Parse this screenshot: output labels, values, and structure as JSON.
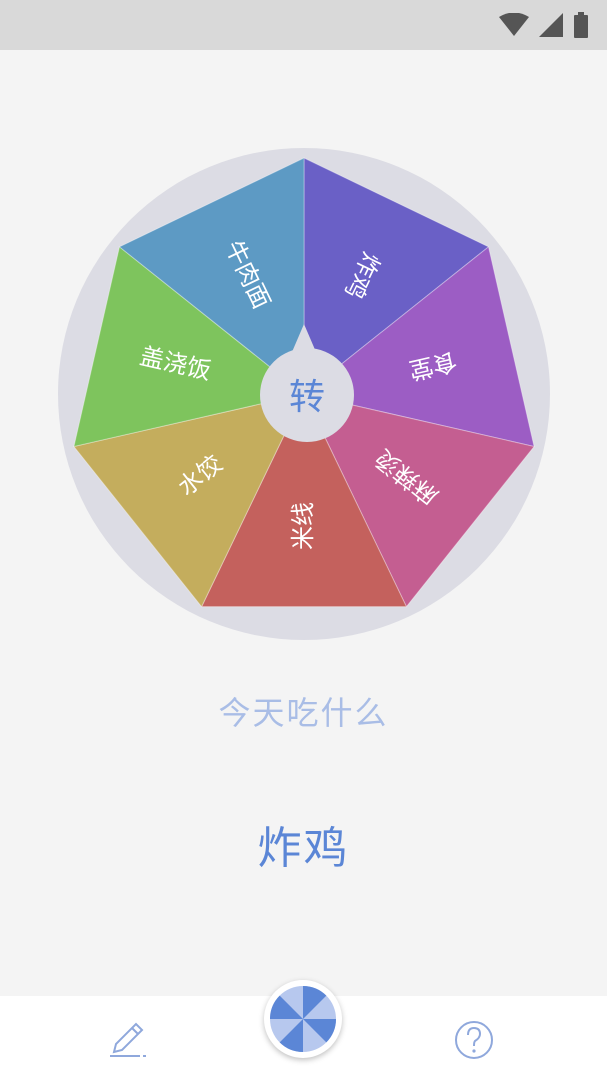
{
  "status_bar": {
    "icons": [
      "wifi-icon",
      "cell-signal-icon",
      "battery-icon"
    ]
  },
  "wheel": {
    "center_label": "转",
    "segments": [
      {
        "label": "炸鸡",
        "color": "#6a60c6"
      },
      {
        "label": "食堂",
        "color": "#9c5dc4"
      },
      {
        "label": "麻辣烫",
        "color": "#c45e91"
      },
      {
        "label": "米线",
        "color": "#c4615d"
      },
      {
        "label": "水饺",
        "color": "#c4ad5d"
      },
      {
        "label": "盖浇饭",
        "color": "#7ec45d"
      },
      {
        "label": "牛肉面",
        "color": "#5d9ac4"
      }
    ],
    "rim_color": "#dcdce4",
    "hub_color": "#dcdce4",
    "hub_text_color": "#5b86d6"
  },
  "prompt": "今天吃什么",
  "result": "炸鸡",
  "bottom_nav": {
    "edit_icon": "pencil-icon",
    "spin_icon": "pinwheel-icon",
    "help_icon": "question-circle-icon",
    "accent": "#5b86d6"
  }
}
